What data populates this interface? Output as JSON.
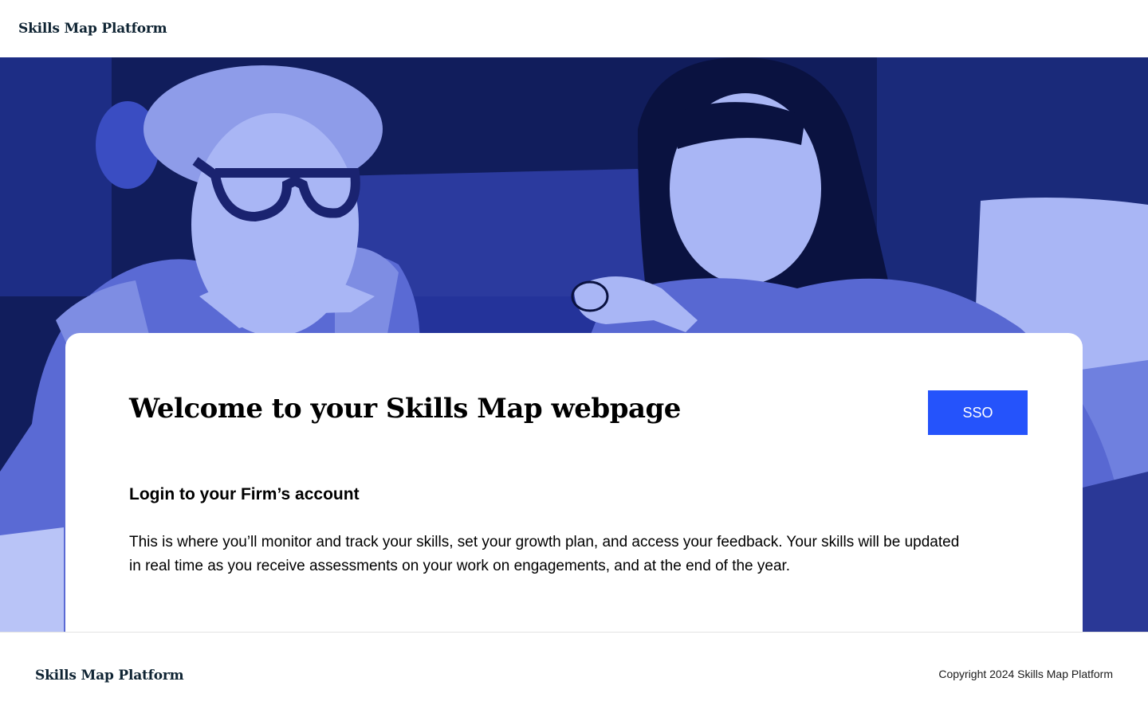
{
  "header": {
    "brand": "Skills Map Platform"
  },
  "hero": {
    "image": "two-women-at-desk-duotone-photo",
    "colors": {
      "dark": "#111d5c",
      "mid": "#3a4dc2",
      "light": "#a9b6f5"
    }
  },
  "card": {
    "title": "Welcome to your Skills Map webpage",
    "sso_label": "SSO",
    "subtitle": "Login to your Firm’s account",
    "body": "This is where you’ll monitor and track your skills, set your growth plan, and access your feedback. Your skills will be updated in real time as you receive assessments on your work on engagements, and at the end of the year."
  },
  "footer": {
    "brand": "Skills Map Platform",
    "copyright": "Copyright 2024 Skills Map Platform"
  },
  "colors": {
    "accent": "#2553fb",
    "brand_text": "#0f2433"
  }
}
